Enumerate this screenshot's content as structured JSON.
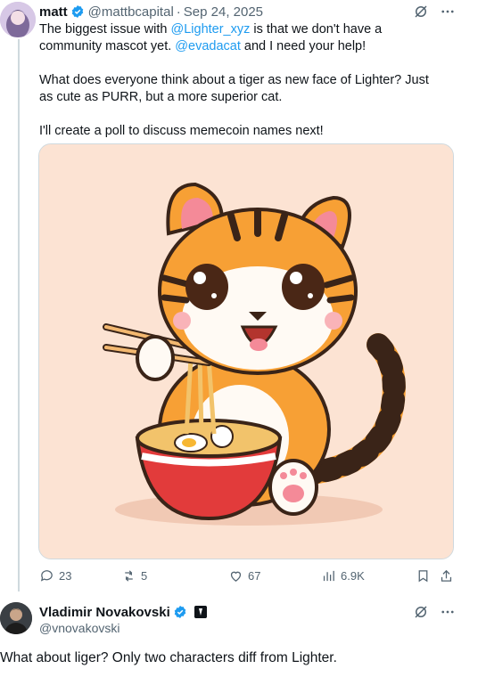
{
  "tweet": {
    "name": "matt",
    "handle": "@mattbcapital",
    "separator": "·",
    "date": "Sep 24, 2025",
    "body": {
      "p1_before": "The biggest issue with ",
      "p1_link": "@Lighter_xyz",
      "p1_mid": " is that we don't have a community mascot yet. ",
      "p1_link2": "@evadacat",
      "p1_after": " and I need your help!",
      "p2": "What does everyone think about a tiger as new face of Lighter? Just as cute as PURR, but a more superior cat.",
      "p3": "I'll create a poll to discuss memecoin names next!"
    },
    "actions": {
      "replies": "23",
      "reposts": "5",
      "likes": "67",
      "views": "6.9K"
    }
  },
  "reply": {
    "name": "Vladimir Novakovski",
    "handle": "@vnovakovski",
    "text": "What about liger?  Only two characters diff from Lighter."
  },
  "colors": {
    "accent": "#1d9bf0",
    "muted": "#536471",
    "verified": "#1d9bf0"
  },
  "icons": [
    "verified-badge-icon",
    "grok-icon",
    "more-icon",
    "reply-icon",
    "repost-icon",
    "like-icon",
    "views-icon",
    "bookmark-icon",
    "share-icon",
    "affiliate-badge-icon"
  ]
}
